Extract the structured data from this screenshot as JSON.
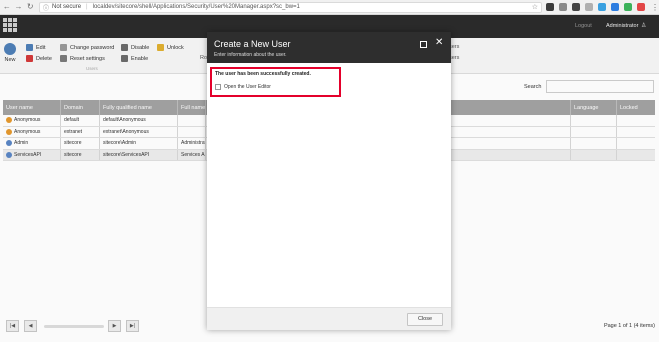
{
  "browser": {
    "security": "Not secure",
    "url": "localdev/sitecore/shell/Applications/Security/User%20Manager.aspx?sc_bw=1"
  },
  "topbar": {
    "logout": "Logout",
    "user": "Administrator"
  },
  "ribbon": {
    "new": "New",
    "edit": "Edit",
    "delete": "Delete",
    "change_password": "Change password",
    "reset_settings": "Reset settings",
    "disable": "Disable",
    "enable": "Enable",
    "unlock": "Unlock",
    "group_label": "Users",
    "ro_fragment": "Ro",
    "rs_fragment_1": "sers",
    "rs_fragment_2": "sers"
  },
  "search": {
    "label": "Search",
    "value": ""
  },
  "grid": {
    "columns": [
      "User name",
      "Domain",
      "Fully qualified name",
      "Full name",
      "Language",
      "Locked"
    ],
    "rows": [
      {
        "user": "Anonymous",
        "domain": "default",
        "fq": "default\\Anonymous",
        "full": "",
        "desc": "",
        "lang": "",
        "locked": ""
      },
      {
        "user": "Anonymous",
        "domain": "extranet",
        "fq": "extranet\\Anonymous",
        "full": "",
        "desc": "",
        "lang": "",
        "locked": ""
      },
      {
        "user": "Admin",
        "domain": "sitecore",
        "fq": "sitecore\\Admin",
        "full": "Administrat",
        "desc": "",
        "lang": "",
        "locked": ""
      },
      {
        "user": "ServicesAPI",
        "domain": "sitecore",
        "fq": "sitecore\\ServicesAPI",
        "full": "Services AP",
        "desc": "ervice APIs.",
        "lang": "",
        "locked": ""
      }
    ]
  },
  "pager": {
    "first": "|◀",
    "prev": "◀",
    "next": "▶",
    "last": "▶|",
    "info": "Page 1 of 1 (4 items)"
  },
  "dialog": {
    "title": "Create a New User",
    "subtitle": "Enter information about the user.",
    "success_message": "The user has been successfully created.",
    "checkbox_label": "Open the User Editor",
    "checkbox_checked": false,
    "close_label": "Close"
  },
  "colors": {
    "topbar": "#2b2b2b",
    "grid_header": "#a3a3a3",
    "highlight": "#e4002b"
  }
}
